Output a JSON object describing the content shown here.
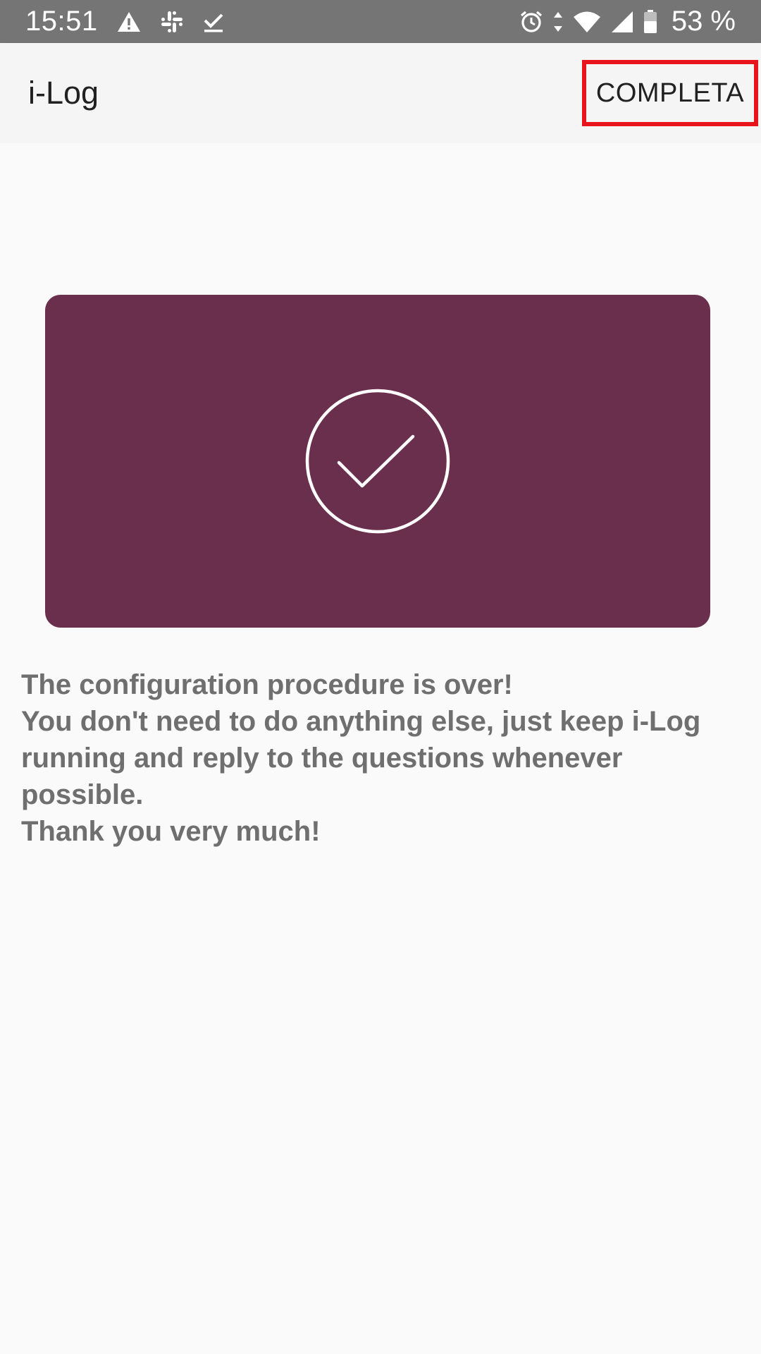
{
  "status_bar": {
    "time": "15:51",
    "left_icons": [
      "warning-icon",
      "slack-icon",
      "checkmark-icon"
    ],
    "right_icons": [
      "alarm-icon",
      "data-arrows-icon",
      "wifi-icon",
      "cell-signal-icon",
      "battery-icon"
    ],
    "battery": "53 %"
  },
  "app_bar": {
    "title": "i-Log",
    "complete_label": "COMPLETA",
    "highlight_color": "#e8141c"
  },
  "card": {
    "color": "#6a2f4c",
    "icon": "check-circle-icon"
  },
  "message": {
    "line1": "The configuration procedure is over!",
    "line2": "You don't need to do anything else, just keep i-Log running and reply to the questions whenever possible.",
    "line3": "Thank you very much!"
  }
}
